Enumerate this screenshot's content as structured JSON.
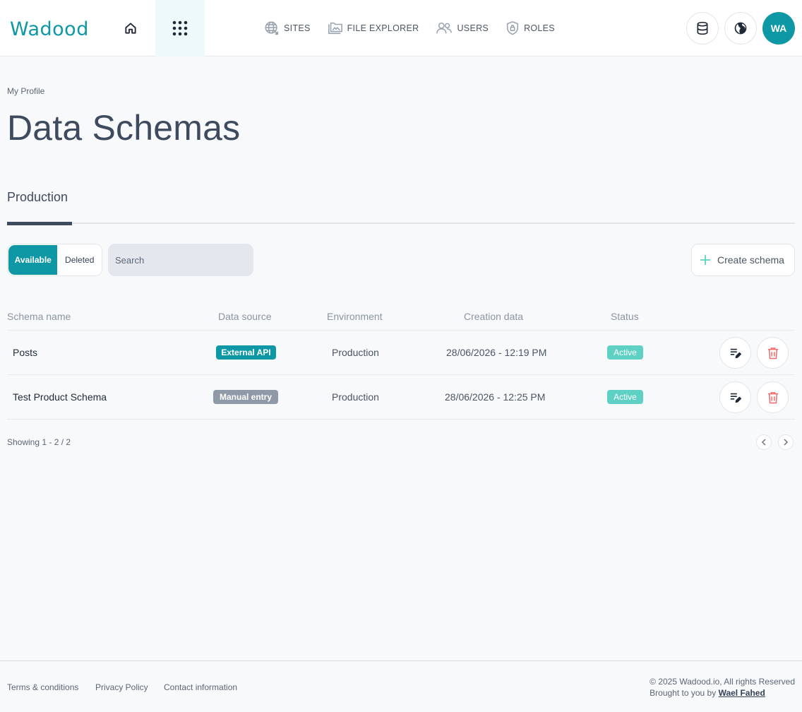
{
  "brand": {
    "logo_text": "Wadood",
    "accent": "#0e97a5"
  },
  "header": {
    "nav": [
      {
        "label": "SITES",
        "icon": "globe-icon"
      },
      {
        "label": "FILE EXPLORER",
        "icon": "folder-icon"
      },
      {
        "label": "USERS",
        "icon": "users-icon"
      },
      {
        "label": "ROLES",
        "icon": "shield-icon"
      }
    ],
    "avatar_initials": "WA"
  },
  "page": {
    "breadcrumb": "My Profile",
    "title": "Data Schemas",
    "tabs": [
      {
        "label": "Production",
        "active": true
      }
    ]
  },
  "toolbar": {
    "filter_active": "Available",
    "filter_inactive": "Deleted",
    "search_placeholder": "Search",
    "create_label": "Create schema"
  },
  "table": {
    "columns": [
      "Schema name",
      "Data source",
      "Environment",
      "Creation data",
      "Status"
    ],
    "rows": [
      {
        "name": "Posts",
        "source": "External API",
        "source_color": "#0e97a5",
        "environment": "Production",
        "created": "28/06/2026 - 12:19 PM",
        "status": "Active"
      },
      {
        "name": "Test Product Schema",
        "source": "Manual entry",
        "source_color": "#8f99a8",
        "environment": "Production",
        "created": "28/06/2026 - 12:25 PM",
        "status": "Active"
      }
    ],
    "showing": "Showing 1 - 2 / 2"
  },
  "footer": {
    "links": [
      "Terms & conditions",
      "Privacy Policy",
      "Contact information"
    ],
    "copyright": "© 2025 Wadood.io, All rights Reserved",
    "brought_by": "Brought to you by",
    "author": "Wael Fahed"
  }
}
